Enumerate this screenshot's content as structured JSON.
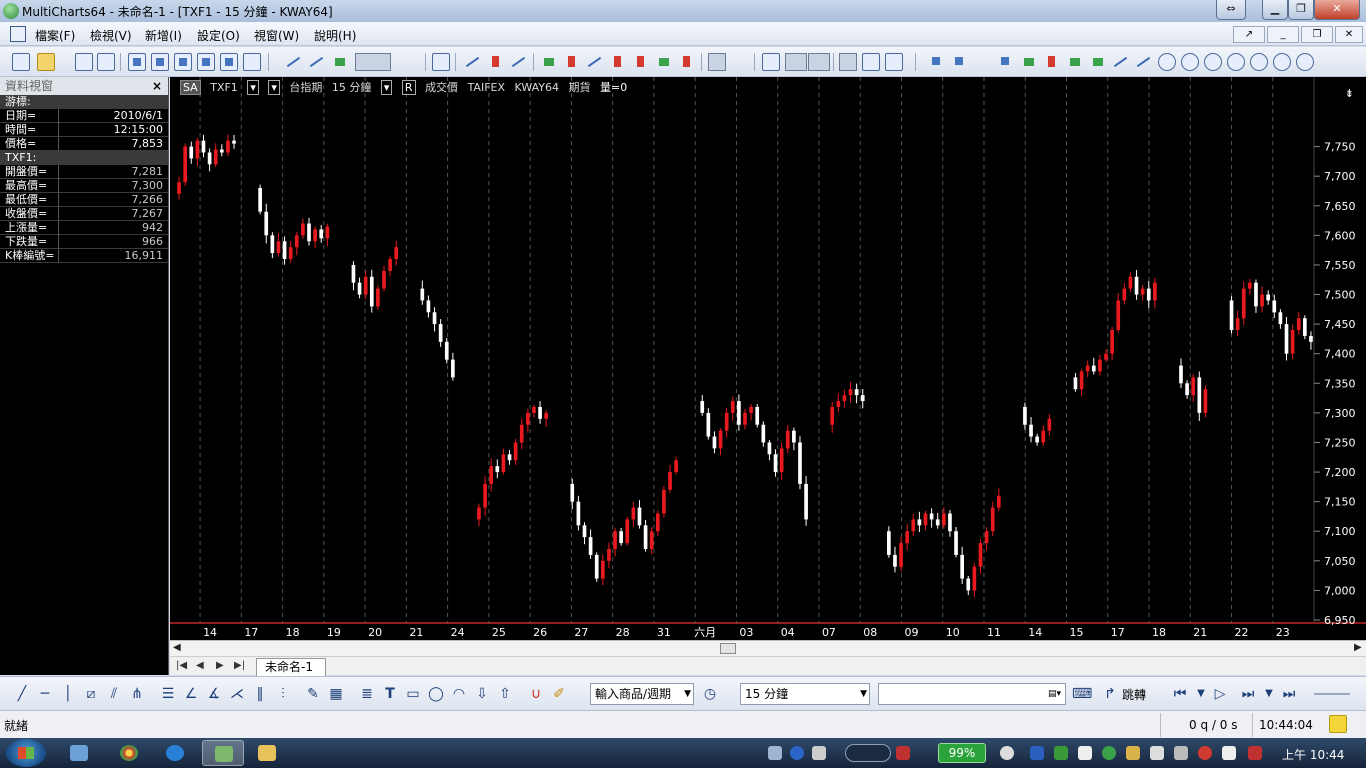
{
  "window": {
    "title": "MultiCharts64 - 未命名-1 - [TXF1 - 15 分鐘 - KWAY64]"
  },
  "menu": {
    "items": [
      "檔案(F)",
      "檢視(V)",
      "新增(I)",
      "設定(O)",
      "視窗(W)",
      "說明(H)"
    ]
  },
  "data_window": {
    "title": "資料視窗",
    "close_glyph": "×",
    "cursor_section": "游標:",
    "cursor_rows": [
      {
        "label": "日期=",
        "value": "2010/6/1"
      },
      {
        "label": "時間=",
        "value": "12:15:00"
      },
      {
        "label": "價格=",
        "value": "7,853"
      }
    ],
    "symbol_section": "TXF1:",
    "symbol_rows": [
      {
        "label": "開盤價=",
        "value": "7,281"
      },
      {
        "label": "最高價=",
        "value": "7,300"
      },
      {
        "label": "最低價=",
        "value": "7,266"
      },
      {
        "label": "收盤價=",
        "value": "7,267"
      },
      {
        "label": "上漲量=",
        "value": "942"
      },
      {
        "label": "下跌量=",
        "value": "966"
      },
      {
        "label": "K棒編號=",
        "value": "16,911"
      }
    ]
  },
  "chart_header": {
    "sa": "SA",
    "symbol": "TXF1",
    "name": "台指期",
    "interval": "15 分鐘",
    "r_box": "R",
    "price_type": "成交價",
    "exchange": "TAIFEX",
    "source": "KWAY64",
    "category": "期貨",
    "volume": "量=0"
  },
  "chart_data": {
    "type": "candlestick",
    "symbol": "TXF1",
    "interval": "15 分鐘",
    "ylim": [
      6950,
      7800
    ],
    "y_ticks": [
      6950,
      7000,
      7050,
      7100,
      7150,
      7200,
      7250,
      7300,
      7350,
      7400,
      7450,
      7500,
      7550,
      7600,
      7650,
      7700,
      7750
    ],
    "y_tick_labels": [
      "6,950",
      "7,000",
      "7,050",
      "7,100",
      "7,150",
      "7,200",
      "7,250",
      "7,300",
      "7,350",
      "7,400",
      "7,450",
      "7,500",
      "7,550",
      "7,600",
      "7,650",
      "7,700",
      "7,750"
    ],
    "x_labels": [
      "14",
      "17",
      "18",
      "19",
      "20",
      "21",
      "24",
      "25",
      "26",
      "27",
      "28",
      "31",
      "六月",
      "03",
      "04",
      "07",
      "08",
      "09",
      "10",
      "11",
      "14",
      "15",
      "17",
      "18",
      "21",
      "22",
      "23"
    ],
    "gridlines": "vertical-dashed",
    "up_color": "#e8191f",
    "down_color": "#ffffff",
    "segments": [
      {
        "start": 7670,
        "path": [
          7690,
          7750,
          7730,
          7760,
          7740,
          7720,
          7745,
          7740,
          7760,
          7755
        ]
      },
      {
        "start": 7680,
        "path": [
          7640,
          7600,
          7570,
          7590,
          7560,
          7580,
          7600,
          7620,
          7590,
          7610,
          7595,
          7615
        ]
      },
      {
        "start": 7550,
        "path": [
          7520,
          7500,
          7530,
          7480,
          7510,
          7540,
          7560,
          7580
        ]
      },
      {
        "start": 7510,
        "path": [
          7490,
          7470,
          7450,
          7420,
          7390,
          7360
        ]
      },
      {
        "start": 7120,
        "path": [
          7140,
          7180,
          7210,
          7200,
          7230,
          7220,
          7250,
          7280,
          7300,
          7310,
          7290,
          7300
        ]
      },
      {
        "start": 7180,
        "path": [
          7150,
          7110,
          7090,
          7060,
          7020,
          7050,
          7070,
          7100,
          7080,
          7120,
          7140,
          7110,
          7070,
          7100,
          7130,
          7170,
          7200,
          7220
        ]
      },
      {
        "start": 7320,
        "path": [
          7300,
          7260,
          7240,
          7270,
          7300,
          7320,
          7280,
          7300,
          7310,
          7280,
          7250,
          7230,
          7200,
          7240,
          7270,
          7250,
          7180,
          7120
        ]
      },
      {
        "start": 7280,
        "path": [
          7310,
          7320,
          7330,
          7340,
          7330,
          7320
        ]
      },
      {
        "start": 7100,
        "path": [
          7060,
          7040,
          7080,
          7100,
          7120,
          7110,
          7130,
          7120,
          7110,
          7130,
          7100,
          7060,
          7020,
          7000,
          7040,
          7080,
          7100,
          7140,
          7160
        ]
      },
      {
        "start": 7310,
        "path": [
          7280,
          7260,
          7250,
          7270,
          7290
        ]
      },
      {
        "start": 7360,
        "path": [
          7340,
          7370,
          7380,
          7370,
          7390,
          7400,
          7440,
          7490,
          7510,
          7530,
          7500,
          7510,
          7490,
          7520
        ]
      },
      {
        "start": 7380,
        "path": [
          7350,
          7330,
          7360,
          7300,
          7340
        ]
      },
      {
        "start": 7490,
        "path": [
          7440,
          7460,
          7510,
          7520,
          7480,
          7500,
          7490,
          7470,
          7450,
          7400,
          7440,
          7460,
          7430,
          7420
        ]
      }
    ]
  },
  "tabs": {
    "nav": [
      "|◀",
      "◀",
      "▶",
      "▶|"
    ],
    "items": [
      "未命名-1"
    ]
  },
  "drawing_toolbar": {
    "symbol_combo": "輸入商品/週期",
    "interval_combo": "15 分鐘",
    "jump_label": "跳轉"
  },
  "status": {
    "ready": "就緒",
    "queue": "0 q / 0 s",
    "time": "10:44:04"
  },
  "taskbar": {
    "battery": "99%",
    "clock": "上午 10:44"
  }
}
